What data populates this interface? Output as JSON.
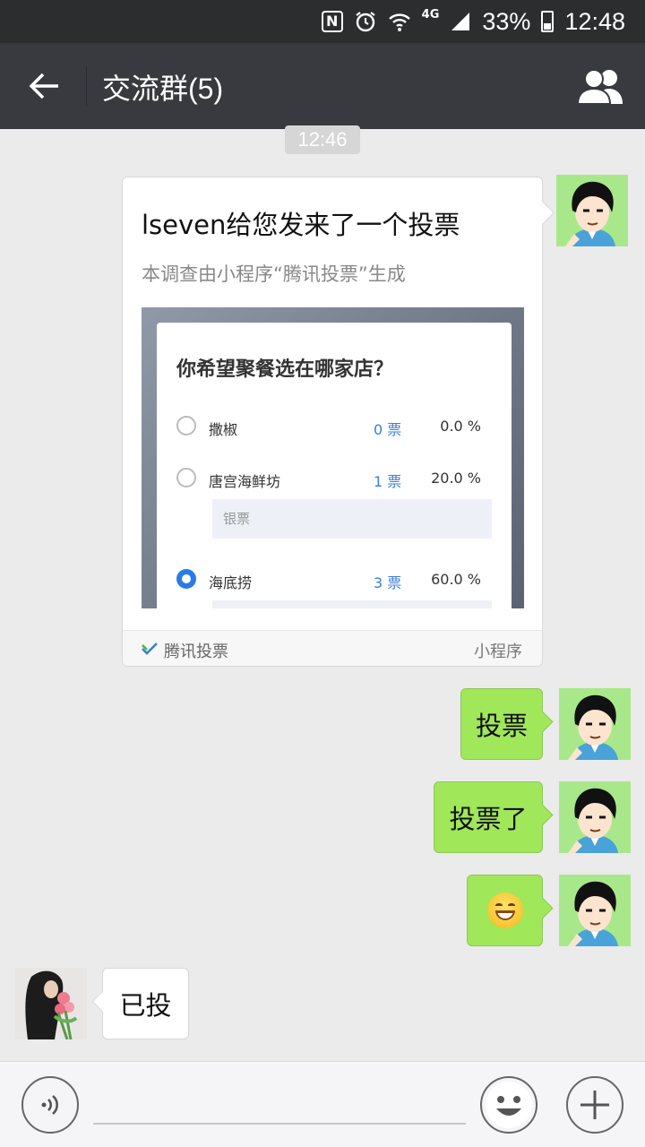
{
  "status_bar": {
    "nfc_icon": "nfc-icon",
    "alarm_icon": "alarm-icon",
    "wifi_icon": "wifi-icon",
    "network": "4G",
    "signal_icon": "signal-icon",
    "battery": "33%",
    "time": "12:48"
  },
  "header": {
    "title": "交流群(5)",
    "back_icon": "back-arrow-icon",
    "members_icon": "group-members-icon"
  },
  "timestamp": "12:46",
  "messages": {
    "card": {
      "title": "lseven给您发来了一个投票",
      "subtitle": "本调查由小程序“腾讯投票”生成",
      "poll": {
        "question": "你希望聚餐选在哪家店？",
        "options": [
          {
            "name": "撒椒",
            "votes": "0 票",
            "percent": "0.0 %",
            "selected": false
          },
          {
            "name": "唐宫海鲜坊",
            "votes": "1 票",
            "percent": "20.0 %",
            "selected": false,
            "voters": "银票"
          },
          {
            "name": "海底捞",
            "votes": "3 票",
            "percent": "60.0 %",
            "selected": true
          }
        ]
      },
      "footer_app": "腾讯投票",
      "footer_tag": "小程序"
    },
    "msg1": "投票",
    "msg2": "投票了",
    "msg3_emoji": "grinning-emoji",
    "msg4": "已投"
  },
  "input_bar": {
    "voice_icon": "voice-icon",
    "emoji_icon": "emoji-icon",
    "plus_icon": "plus-icon"
  },
  "colors": {
    "status_bg": "#2b2d2f",
    "title_bg": "#393a3f",
    "chat_bg": "#ebebeb",
    "my_bubble": "#a0e75a",
    "avatar_bg": "#a8e88a",
    "link_blue": "#3b7fd6"
  }
}
